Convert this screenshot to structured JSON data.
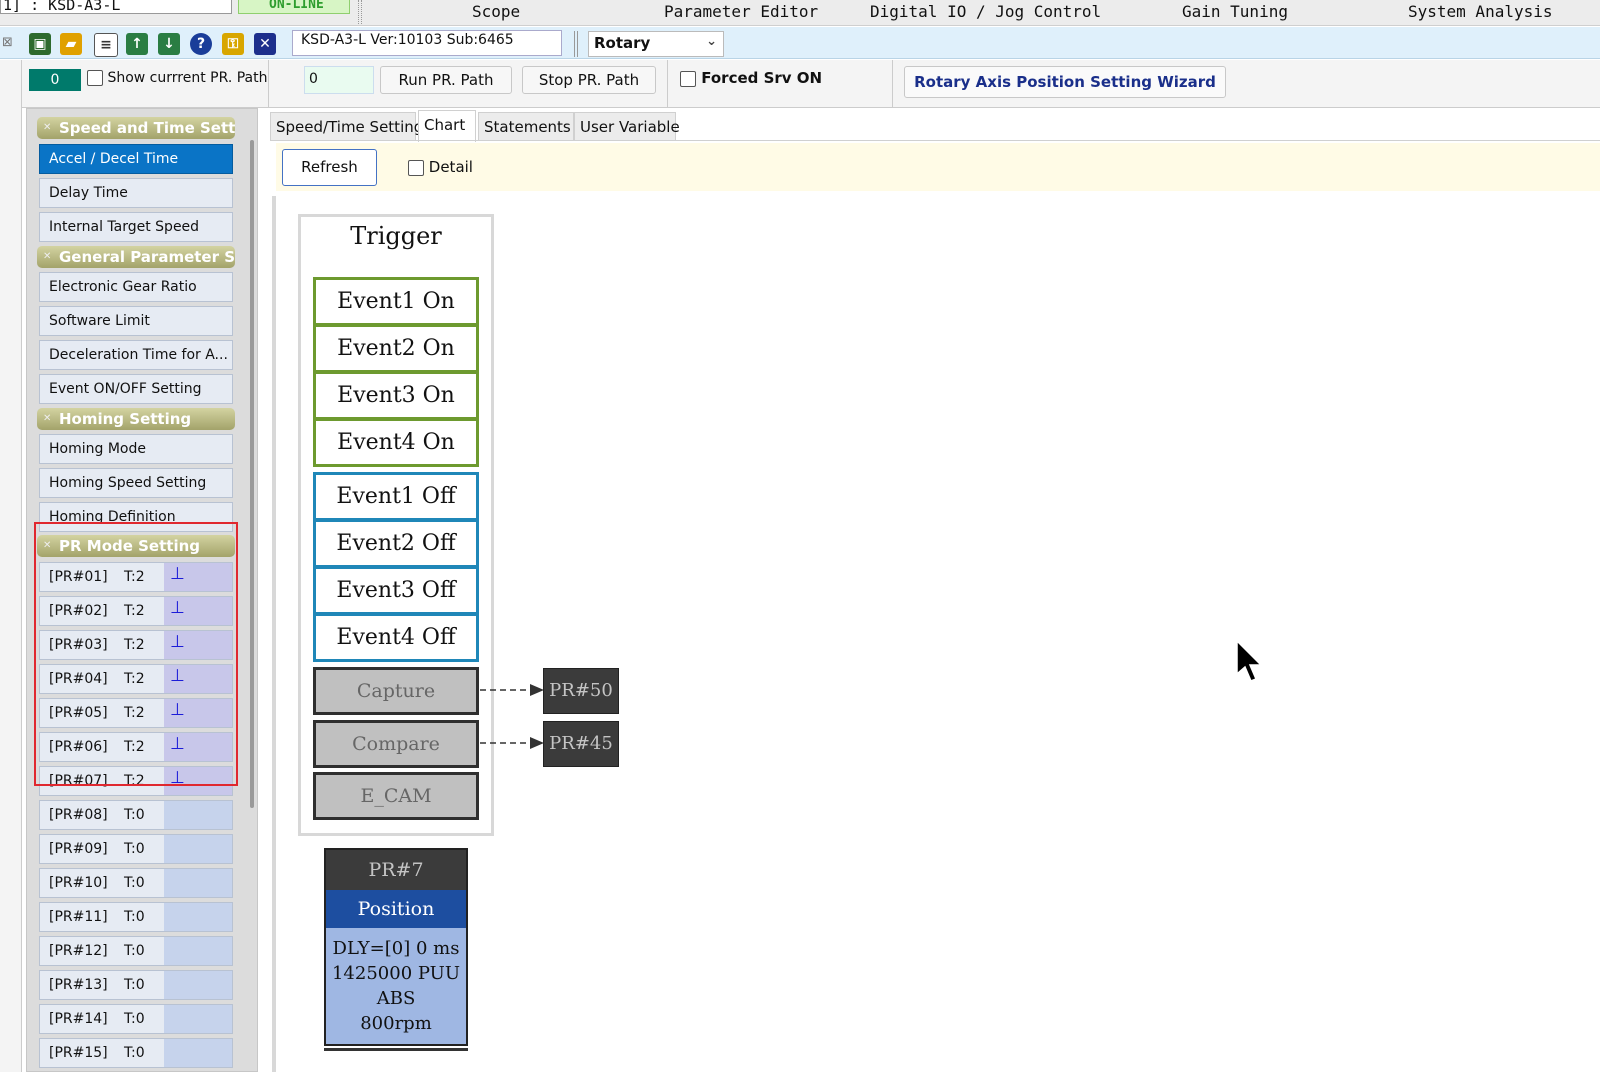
{
  "top_menu": {
    "device_combo": "1] : KSD-A3-L",
    "online_status": "ON-LINE",
    "items": [
      "Scope",
      "Parameter Editor",
      "Digital IO / Jog Control",
      "Gain Tuning",
      "System Analysis"
    ]
  },
  "toolbar": {
    "version": "KSD-A3-L Ver:10103 Sub:6465",
    "axis_mode": "Rotary",
    "icons": [
      "save-icon",
      "open-folder-icon",
      "document-icon",
      "upload-icon",
      "download-icon",
      "help-icon",
      "lock-icon",
      "disconnect-icon"
    ]
  },
  "control_row": {
    "pr_counter": "0",
    "show_current_path_label": "Show currrent PR. Path",
    "pr_input_value": "0",
    "run_button": "Run PR. Path",
    "stop_button": "Stop PR. Path",
    "forced_srv_label": "Forced Srv ON",
    "wizard_button": "Rotary Axis Position Setting Wizard"
  },
  "sidebar": {
    "sections": [
      {
        "title": "Speed and Time Setti...",
        "items": [
          "Accel / Decel Time",
          "Delay Time",
          "Internal Target Speed"
        ]
      },
      {
        "title": "General Parameter S...",
        "items": [
          "Electronic Gear Ratio",
          "Software Limit",
          "Deceleration Time for A...",
          "Event ON/OFF Setting"
        ]
      },
      {
        "title": "Homing Setting",
        "items": [
          "Homing Mode",
          "Homing Speed Setting",
          "Homing Definition"
        ]
      },
      {
        "title": "PR Mode Setting",
        "items": []
      }
    ],
    "active_item": "Accel / Decel Time",
    "pr_items": [
      {
        "id": "[PR#01]",
        "t": "T:2",
        "defined": true
      },
      {
        "id": "[PR#02]",
        "t": "T:2",
        "defined": true
      },
      {
        "id": "[PR#03]",
        "t": "T:2",
        "defined": true
      },
      {
        "id": "[PR#04]",
        "t": "T:2",
        "defined": true
      },
      {
        "id": "[PR#05]",
        "t": "T:2",
        "defined": true
      },
      {
        "id": "[PR#06]",
        "t": "T:2",
        "defined": true
      },
      {
        "id": "[PR#07]",
        "t": "T:2",
        "defined": true
      },
      {
        "id": "[PR#08]",
        "t": "T:0",
        "defined": false
      },
      {
        "id": "[PR#09]",
        "t": "T:0",
        "defined": false
      },
      {
        "id": "[PR#10]",
        "t": "T:0",
        "defined": false
      },
      {
        "id": "[PR#11]",
        "t": "T:0",
        "defined": false
      },
      {
        "id": "[PR#12]",
        "t": "T:0",
        "defined": false
      },
      {
        "id": "[PR#13]",
        "t": "T:0",
        "defined": false
      },
      {
        "id": "[PR#14]",
        "t": "T:0",
        "defined": false
      },
      {
        "id": "[PR#15]",
        "t": "T:0",
        "defined": false
      }
    ]
  },
  "tabs": [
    {
      "label": "Speed/Time Setting",
      "active": false
    },
    {
      "label": "Chart",
      "active": true
    },
    {
      "label": "Statements",
      "active": false
    },
    {
      "label": "User Variable",
      "active": false
    }
  ],
  "chart_panel": {
    "refresh_button": "Refresh",
    "detail_label": "Detail",
    "trigger_title": "Trigger",
    "events_on": [
      "Event1 On",
      "Event2 On",
      "Event3 On",
      "Event4 On"
    ],
    "events_off": [
      "Event1 Off",
      "Event2 Off",
      "Event3 Off",
      "Event4 Off"
    ],
    "capture": {
      "label": "Capture",
      "target": "PR#50"
    },
    "compare": {
      "label": "Compare",
      "target": "PR#45"
    },
    "ecam": "E_CAM",
    "pr_block": {
      "title": "PR#7",
      "type": "Position",
      "lines": [
        "DLY=[0] 0 ms",
        "1425000 PUU",
        "ABS",
        "800rpm"
      ]
    }
  },
  "colors": {
    "accent_blue": "#0a74c6",
    "event_on_border": "#6d9a2f",
    "event_off_border": "#1f87b8",
    "position_header": "#1d4ea0",
    "position_body": "#9fb7e3",
    "highlight_red": "#e0282f"
  }
}
